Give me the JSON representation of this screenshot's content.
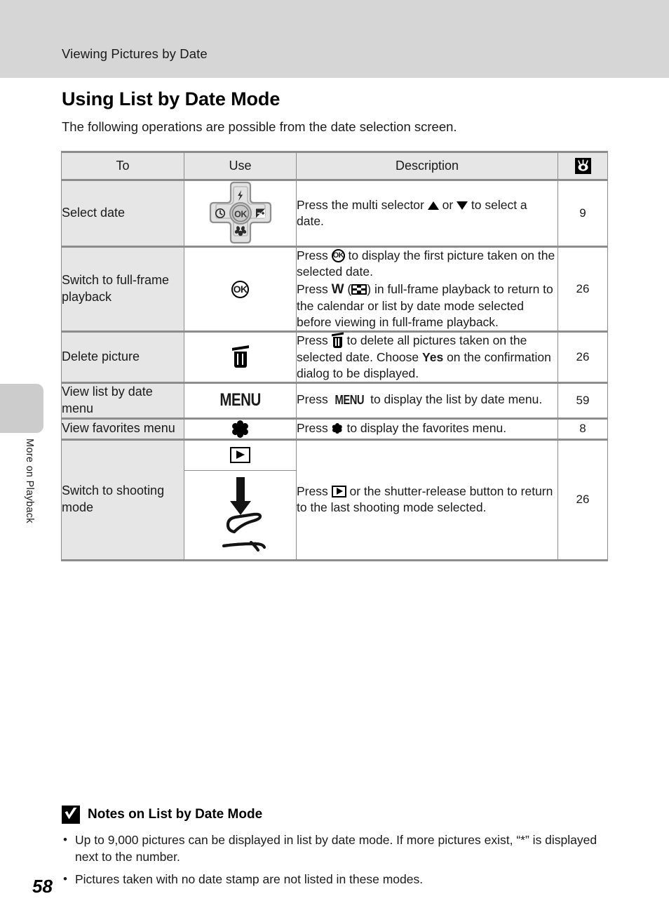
{
  "header": {
    "running_title": "Viewing Pictures by Date"
  },
  "side_tab": {
    "label": "More on Playback"
  },
  "page": {
    "heading": "Using List by Date Mode",
    "intro": "The following operations are possible from the date selection screen.",
    "number": "58"
  },
  "table": {
    "columns": {
      "to": "To",
      "use": "Use",
      "description": "Description",
      "reference_icon": "eye-reference-icon"
    },
    "rows": [
      {
        "to": "Select date",
        "use_icon": "multi-selector-icon",
        "desc_pre": "Press the multi selector ",
        "desc_mid": " or ",
        "desc_post": " to select a date.",
        "page": "9"
      },
      {
        "to": "Switch to full-frame playback",
        "use_icon": "ok-button-icon",
        "desc_l1_pre": "Press ",
        "desc_l1_post": " to display the first picture taken on the selected date.",
        "desc_l2_pre": "Press ",
        "desc_l2_w": "W",
        "desc_l2_open": " (",
        "desc_l2_close": ") in full-frame playback to return to the calendar or list by date mode selected before viewing in full-frame playback.",
        "page": "26"
      },
      {
        "to": "Delete picture",
        "use_icon": "trash-icon",
        "desc_pre": "Press ",
        "desc_mid": " to delete all pictures taken on the selected date. Choose ",
        "desc_bold": "Yes",
        "desc_post": " on the confirmation dialog to be displayed.",
        "page": "26"
      },
      {
        "to": "View list by date menu",
        "use_icon": "menu-button-icon",
        "use_label": "MENU",
        "desc_pre": "Press ",
        "desc_mid": "MENU",
        "desc_post": " to display the list by date menu.",
        "page": "59"
      },
      {
        "to": "View favorites menu",
        "use_icon": "favorites-asterisk-icon",
        "desc_pre": "Press ",
        "desc_post": " to display the favorites menu.",
        "page": "8"
      },
      {
        "to": "Switch to shooting mode",
        "use_icon_top": "playback-button-icon",
        "use_icon_bottom": "shutter-release-finger-icon",
        "desc_pre": "Press ",
        "desc_post": " or the shutter-release button to return to the last shooting mode selected.",
        "page": "26"
      }
    ]
  },
  "notes": {
    "icon": "note-check-icon",
    "title": "Notes on List by Date Mode",
    "items": [
      "Up to 9,000 pictures can be displayed in list by date mode. If more pictures exist, “*” is displayed next to the number.",
      "Pictures taken with no date stamp are not listed in these modes."
    ]
  },
  "colors": {
    "header_band": "#d6d6d6",
    "table_header_fill": "#e6e6e6",
    "table_border": "#8c8c8c",
    "side_tab": "#cccccc"
  }
}
